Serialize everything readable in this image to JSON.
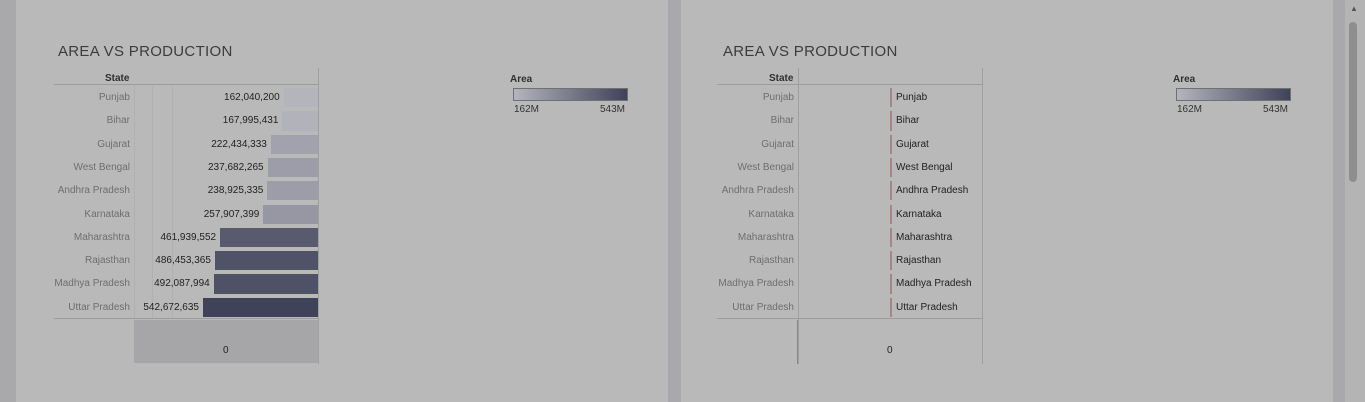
{
  "chart_data": [
    {
      "type": "bar",
      "title": "AREA VS PRODUCTION",
      "row_header": "State",
      "categories": [
        "Punjab",
        "Bihar",
        "Gujarat",
        "West Bengal",
        "Andhra Pradesh",
        "Karnataka",
        "Maharashtra",
        "Rajasthan",
        "Madhya Pradesh",
        "Uttar Pradesh"
      ],
      "values": [
        162040200,
        167995431,
        222434333,
        237682265,
        238925335,
        257907399,
        461939552,
        486453365,
        492087994,
        542672635
      ],
      "value_labels": [
        "162,040,200",
        "167,995,431",
        "222,434,333",
        "237,682,265",
        "238,925,335",
        "257,907,399",
        "461,939,552",
        "486,453,365",
        "492,087,994",
        "542,672,635"
      ],
      "bar_direction": "right-to-left",
      "lower_axis_label": "0",
      "legend": {
        "title": "Area",
        "min_label": "162M",
        "max_label": "543M",
        "min": 162040200,
        "max": 542672635,
        "color_low": "#b4b4bd",
        "color_high": "#3f4259"
      }
    },
    {
      "type": "table",
      "title": "AREA VS PRODUCTION",
      "row_header": "State",
      "categories": [
        "Punjab",
        "Bihar",
        "Gujarat",
        "West Bengal",
        "Andhra Pradesh",
        "Karnataka",
        "Maharashtra",
        "Rajasthan",
        "Madhya Pradesh",
        "Uttar Pradesh"
      ],
      "lower_axis_label": "0",
      "legend": {
        "title": "Area",
        "min_label": "162M",
        "max_label": "543M"
      }
    }
  ]
}
